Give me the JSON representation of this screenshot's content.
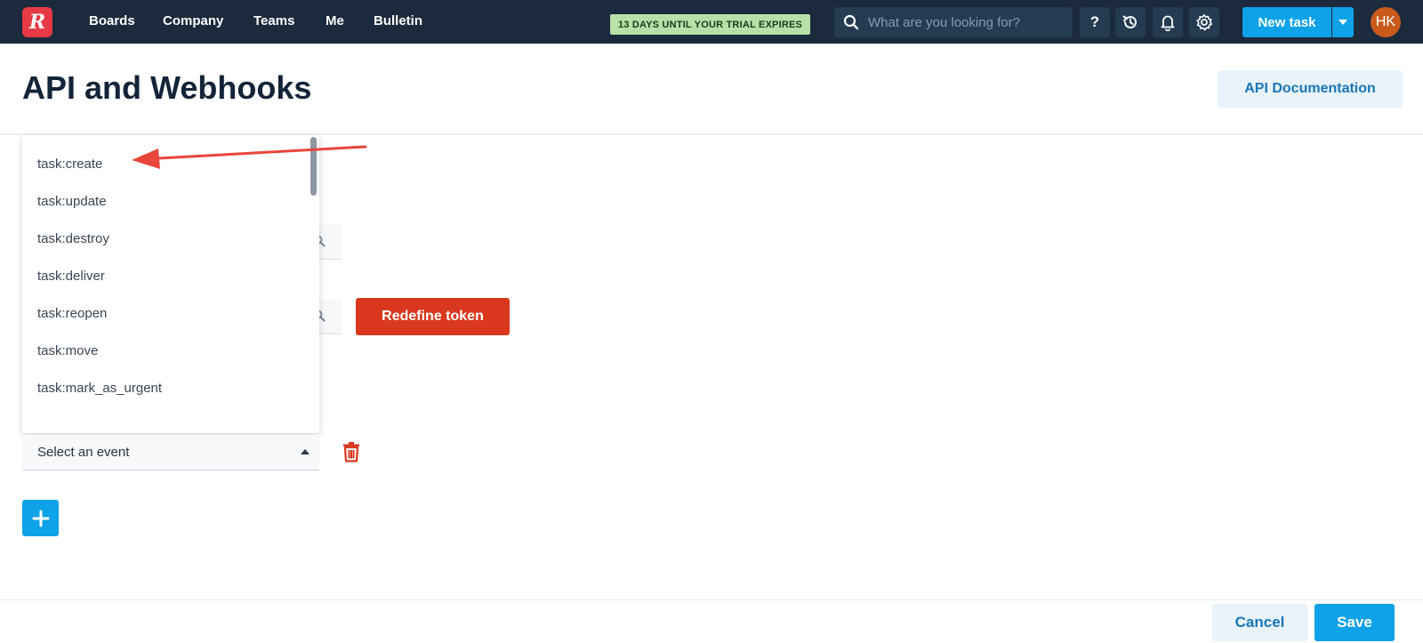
{
  "nav": {
    "items": [
      "Boards",
      "Company",
      "Teams",
      "Me",
      "Bulletin"
    ],
    "trial_badge": "13 DAYS UNTIL YOUR TRIAL EXPIRES",
    "search_placeholder": "What are you looking for?",
    "help_label": "?",
    "new_task_label": "New task",
    "avatar_initials": "HK"
  },
  "page": {
    "title": "API and Webhooks",
    "api_doc_label": "API Documentation",
    "redefine_token_label": "Redefine token"
  },
  "event_dropdown": {
    "options": [
      "task:create",
      "task:update",
      "task:destroy",
      "task:deliver",
      "task:reopen",
      "task:move",
      "task:mark_as_urgent"
    ],
    "placeholder": "Select an event"
  },
  "footer": {
    "cancel_label": "Cancel",
    "save_label": "Save"
  },
  "colors": {
    "nav_bg": "#1b2a3c",
    "accent_blue": "#0ea2e8",
    "danger_red": "#d9381e",
    "trial_green": "#b6e0a8",
    "annotation_arrow": "#e8463a"
  },
  "icons": [
    "logo",
    "search-icon",
    "help-icon",
    "history-icon",
    "bell-icon",
    "gear-icon",
    "caret-down-icon",
    "caret-up-icon",
    "trash-icon",
    "plus-icon"
  ]
}
